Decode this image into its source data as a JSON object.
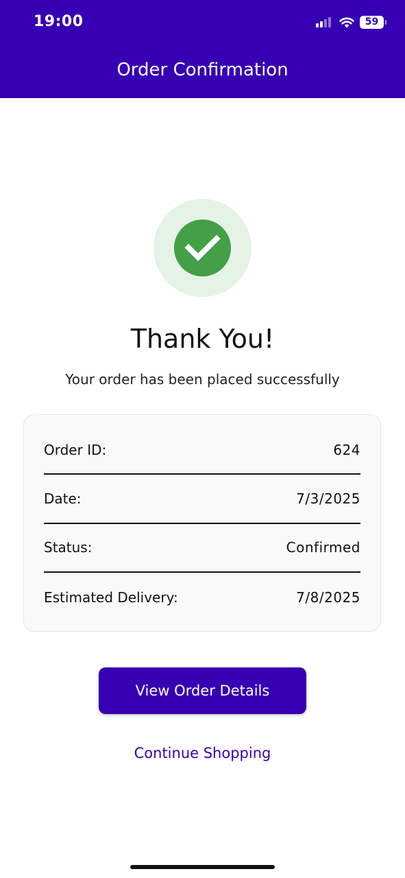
{
  "status_bar": {
    "time": "19:00",
    "battery_level": "59",
    "icons": [
      "signal-icon",
      "wifi-icon",
      "battery-icon"
    ]
  },
  "header": {
    "title": "Order Confirmation",
    "background_color": "#3700b3"
  },
  "confirmation": {
    "icon": "checkmark-icon",
    "icon_color": "#43a047",
    "title": "Thank You!",
    "subtitle": "Your order has been placed successfully"
  },
  "order_summary": {
    "rows": [
      {
        "label": "Order ID:",
        "value": "624"
      },
      {
        "label": "Date:",
        "value": "7/3/2025"
      },
      {
        "label": "Status:",
        "value": "Confirmed"
      },
      {
        "label": "Estimated Delivery:",
        "value": "7/8/2025"
      }
    ]
  },
  "actions": {
    "view_details_label": "View Order Details",
    "continue_shopping_label": "Continue Shopping",
    "accent_color": "#3700b3"
  }
}
